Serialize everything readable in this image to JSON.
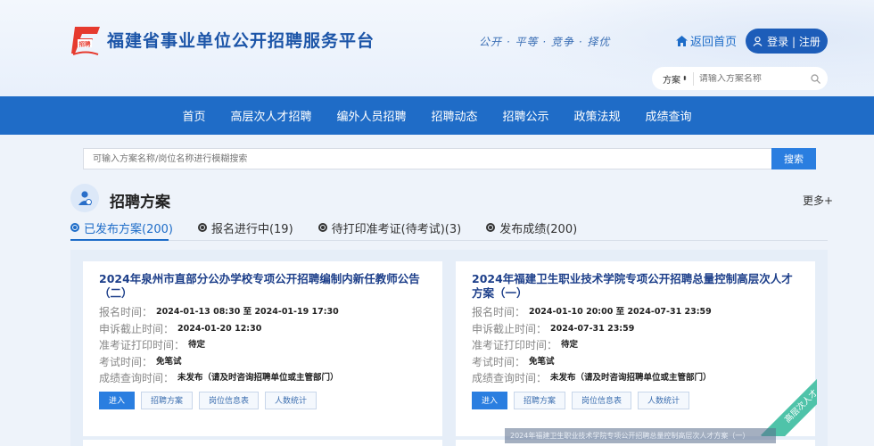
{
  "header": {
    "title": "福建省事业单位公开招聘服务平台",
    "slogan": "公开 · 平等 · 竞争 · 择优",
    "home_link": "返回首页",
    "login": "登录 | 注册",
    "search": {
      "select_value": "方案",
      "placeholder": "请输入方案名称"
    },
    "colors": {
      "brand": "#1c55a8",
      "accent": "#e63a2e"
    }
  },
  "nav": {
    "items": [
      "首页",
      "高层次人才招聘",
      "编外人员招聘",
      "招聘动态",
      "招聘公示",
      "政策法规",
      "成绩查询"
    ]
  },
  "main_search": {
    "placeholder": "可输入方案名称/岗位名称进行模糊搜索",
    "button": "搜索"
  },
  "section": {
    "title": "招聘方案",
    "more": "更多+",
    "tabs": [
      {
        "label": "已发布方案(200)",
        "active": true
      },
      {
        "label": "报名进行中(19)",
        "active": false
      },
      {
        "label": "待打印准考证(待考试)(3)",
        "active": false
      },
      {
        "label": "发布成绩(200)",
        "active": false
      }
    ]
  },
  "cards": [
    {
      "title": "2024年泉州市直部分公办学校专项公开招聘编制内新任教师公告（二）",
      "fields": [
        {
          "label": "报名时间：",
          "value": "2024-01-13 08:30 至 2024-01-19 17:30"
        },
        {
          "label": "申诉截止时间：",
          "value": "2024-01-20 12:30"
        },
        {
          "label": "准考证打印时间：",
          "value": "待定"
        },
        {
          "label": "考试时间：",
          "value": "免笔试"
        },
        {
          "label": "成绩查询时间：",
          "value": "未发布（请及时咨询招聘单位或主管部门）"
        }
      ],
      "buttons": [
        "进入",
        "招聘方案",
        "岗位信息表",
        "人数统计"
      ]
    },
    {
      "title": "2024年福建卫生职业技术学院专项公开招聘总量控制高层次人才方案（一）",
      "fields": [
        {
          "label": "报名时间：",
          "value": "2024-01-10 20:00 至 2024-07-31 23:59"
        },
        {
          "label": "申诉截止时间：",
          "value": "2024-07-31 23:59"
        },
        {
          "label": "准考证打印时间：",
          "value": "待定"
        },
        {
          "label": "考试时间：",
          "value": "免笔试"
        },
        {
          "label": "成绩查询时间：",
          "value": "未发布（请及时咨询招聘单位或主管部门）"
        }
      ],
      "buttons": [
        "进入",
        "招聘方案",
        "岗位信息表",
        "人数统计"
      ],
      "ribbon": "高层次人才"
    }
  ],
  "tooltip": "2024年福建卫生职业技术学院专项公开招聘总量控制高层次人才方案（一）"
}
